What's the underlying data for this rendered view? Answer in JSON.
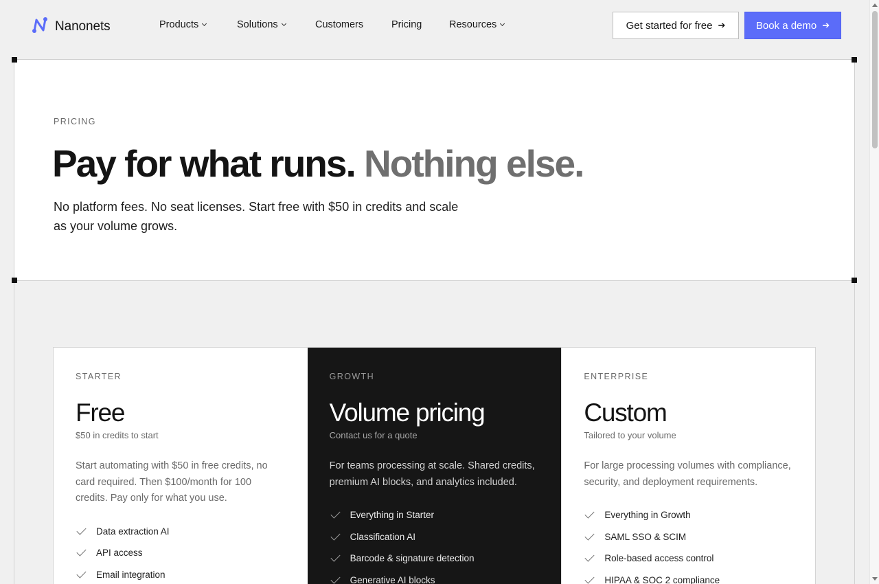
{
  "brand": {
    "name": "Nanonets",
    "accent": "#5b6cf9",
    "logo_icon": "nanonets-logo-icon"
  },
  "nav": {
    "items": [
      {
        "label": "Products",
        "has_dropdown": true
      },
      {
        "label": "Solutions",
        "has_dropdown": true
      },
      {
        "label": "Customers",
        "has_dropdown": false
      },
      {
        "label": "Pricing",
        "has_dropdown": false
      },
      {
        "label": "Resources",
        "has_dropdown": true
      }
    ],
    "cta_secondary": "Get started for free",
    "cta_primary": "Book a demo",
    "arrow_glyph": "➔"
  },
  "hero": {
    "eyebrow": "PRICING",
    "headline_main": "Pay for what runs.",
    "headline_muted": "Nothing else.",
    "subtitle": "No platform fees. No seat licenses. Start free with $50 in credits and scale as your volume grows."
  },
  "plans": [
    {
      "tier": "STARTER",
      "price": "Free",
      "note": "$50 in credits to start",
      "description": "Start automating with $50 in free credits, no card required. Then $100/month for 100 credits. Pay only for what you use.",
      "features": [
        "Data extraction AI",
        "API access",
        "Email integration"
      ]
    },
    {
      "tier": "GROWTH",
      "price": "Volume pricing",
      "note": "Contact us for a quote",
      "description": "For teams processing at scale. Shared credits, premium AI blocks, and analytics included.",
      "features": [
        "Everything in Starter",
        "Classification AI",
        "Barcode & signature detection",
        "Generative AI blocks"
      ]
    },
    {
      "tier": "ENTERPRISE",
      "price": "Custom",
      "note": "Tailored to your volume",
      "description": "For large processing volumes with compliance, security, and deployment requirements.",
      "features": [
        "Everything in Growth",
        "SAML SSO & SCIM",
        "Role-based access control",
        "HIPAA & SOC 2 compliance"
      ]
    }
  ]
}
